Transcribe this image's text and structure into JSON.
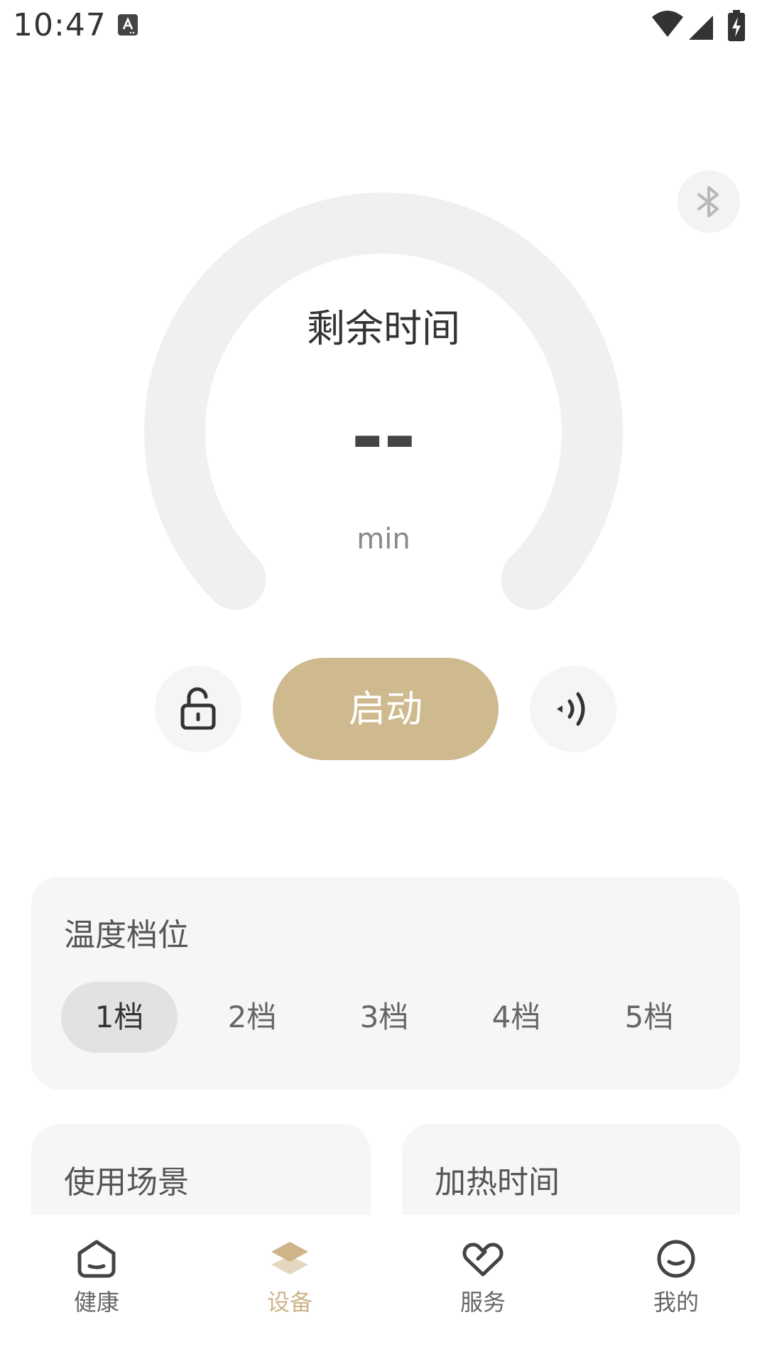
{
  "status_bar": {
    "time": "10:47"
  },
  "gauge": {
    "title": "剩余时间",
    "value": "--",
    "unit": "min"
  },
  "controls": {
    "start_label": "启动"
  },
  "temperature": {
    "title": "温度档位",
    "options": [
      "1档",
      "2档",
      "3档",
      "4档",
      "5档"
    ],
    "selected": "1档"
  },
  "scene": {
    "title": "使用场景"
  },
  "heating": {
    "title": "加热时间"
  },
  "nav": {
    "items": [
      {
        "label": "健康",
        "icon": "home-icon"
      },
      {
        "label": "设备",
        "icon": "layers-icon"
      },
      {
        "label": "服务",
        "icon": "heart-icon"
      },
      {
        "label": "我的",
        "icon": "face-icon"
      }
    ],
    "active": "设备"
  },
  "colors": {
    "accent": "#cfba90",
    "nav_active": "#cfb48a",
    "gauge_track": "#f0f0f0",
    "card_bg": "#f6f6f6"
  }
}
